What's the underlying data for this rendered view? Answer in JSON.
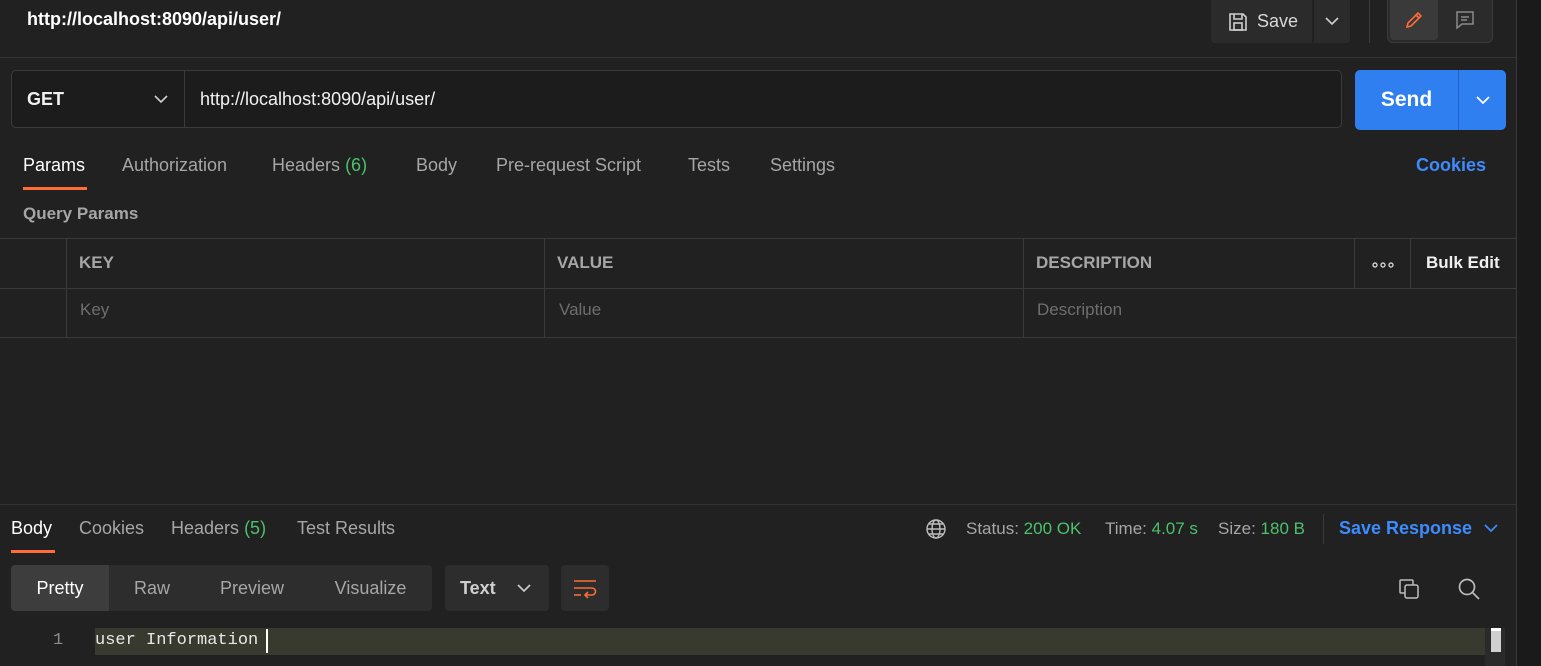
{
  "request": {
    "title": "http://localhost:8090/api/user/",
    "method": "GET",
    "url": "http://localhost:8090/api/user/"
  },
  "toolbar": {
    "save_label": "Save",
    "send_label": "Send"
  },
  "request_tabs": [
    {
      "label": "Params",
      "active": true
    },
    {
      "label": "Authorization"
    },
    {
      "label": "Headers",
      "count": "(6)"
    },
    {
      "label": "Body"
    },
    {
      "label": "Pre-request Script"
    },
    {
      "label": "Tests"
    },
    {
      "label": "Settings"
    }
  ],
  "cookies_link": "Cookies",
  "query_params": {
    "title": "Query Params",
    "columns": [
      "KEY",
      "VALUE",
      "DESCRIPTION"
    ],
    "bulk_edit": "Bulk Edit",
    "placeholders": {
      "key": "Key",
      "value": "Value",
      "description": "Description"
    }
  },
  "response": {
    "tabs": [
      {
        "label": "Body",
        "active": true
      },
      {
        "label": "Cookies"
      },
      {
        "label": "Headers",
        "count": "(5)"
      },
      {
        "label": "Test Results"
      }
    ],
    "status_label": "Status:",
    "status_value": "200 OK",
    "time_label": "Time:",
    "time_value": "4.07 s",
    "size_label": "Size:",
    "size_value": "180 B",
    "save_response": "Save Response",
    "formats": [
      "Pretty",
      "Raw",
      "Preview",
      "Visualize"
    ],
    "active_format": "Pretty",
    "content_type": "Text",
    "lines": [
      {
        "number": "1",
        "text": "user Information"
      }
    ]
  },
  "colors": {
    "accent": "#ff6c37",
    "primary": "#2f7ff0",
    "link": "#3d8bfd",
    "success": "#4bc16b"
  }
}
